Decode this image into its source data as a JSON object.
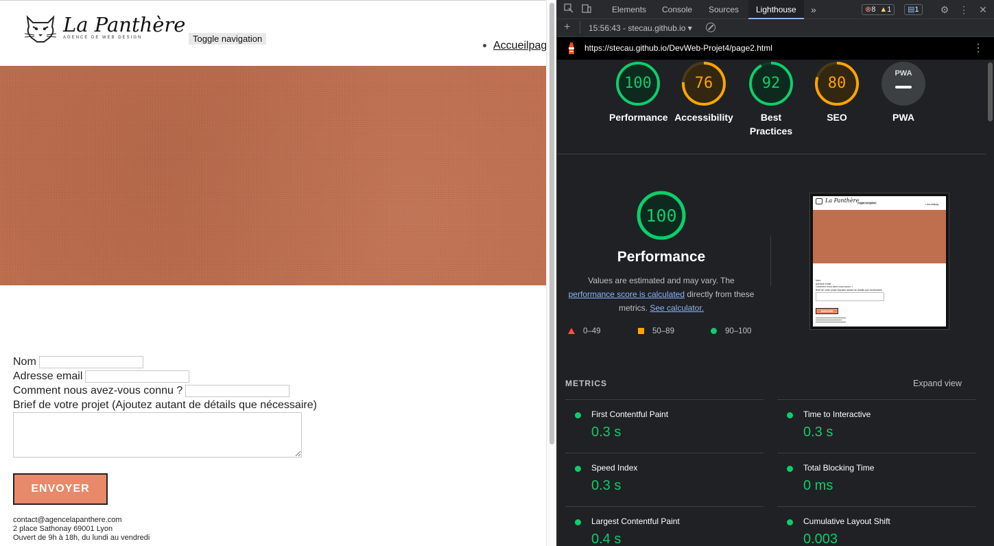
{
  "site": {
    "logo_title": "La Panthère",
    "logo_subtitle": "AGENCE DE WEB DESIGN",
    "toggle_nav": "Toggle navigation",
    "nav_items": [
      "Accueilpag"
    ],
    "form": {
      "name_label": "Nom",
      "email_label": "Adresse email",
      "source_label": "Comment nous avez-vous connu ?",
      "brief_label": "Brief de votre projet (Ajoutez autant de détails que nécessaire)",
      "submit": "ENVOYER"
    },
    "footer": [
      "contact@agencelapanthere.com",
      "2 place Sathonay 69001 Lyon",
      "Ouvert de 9h à 18h, du lundi au vendredi"
    ],
    "hero_color": "#bf6e4e",
    "button_color": "#e8896a"
  },
  "devtools": {
    "tabs": [
      "Elements",
      "Console",
      "Sources",
      "Lighthouse"
    ],
    "active_tab": "Lighthouse",
    "more_tabs": "»",
    "badges": {
      "errors": "8",
      "warnings": "1",
      "messages": "1"
    },
    "toolbar_report": "15:56:43 - stecau.github.io",
    "url": "https://stecau.github.io/DevWeb-Projet4/page2.html",
    "scores": [
      {
        "label": "Performance",
        "value": 100,
        "color": "#0cce6b"
      },
      {
        "label": "Accessibility",
        "value": 76,
        "color": "#ffa400"
      },
      {
        "label": "Best Practices",
        "value": 92,
        "color": "#0cce6b"
      },
      {
        "label": "SEO",
        "value": 80,
        "color": "#ffa400"
      },
      {
        "label": "PWA",
        "value": null,
        "color": "#9aa0a6",
        "badge_text": "PWA"
      }
    ],
    "performance": {
      "score": 100,
      "title": "Performance",
      "desc_before": "Values are estimated and may vary. The",
      "link_calc": "performance score is calculated",
      "desc_middle": "directly from these metrics.",
      "link_see": "See calculator."
    },
    "legend": [
      "0–49",
      "50–89",
      "90–100"
    ],
    "metrics_title": "METRICS",
    "expand_view": "Expand view",
    "metrics": [
      {
        "name": "First Contentful Paint",
        "value": "0.3 s"
      },
      {
        "name": "Time to Interactive",
        "value": "0.3 s"
      },
      {
        "name": "Speed Index",
        "value": "0.3 s"
      },
      {
        "name": "Total Blocking Time",
        "value": "0 ms"
      },
      {
        "name": "Largest Contentful Paint",
        "value": "0.4 s"
      },
      {
        "name": "Cumulative Layout Shift",
        "value": "0.003"
      }
    ],
    "thumbnail": {
      "logo": "La Panthère",
      "toggle": "Toggle navigation",
      "nav": "• Accueilpag",
      "lines": [
        "Nom",
        "Adresse email",
        "Comment nous avez-vous connu ?",
        "Brief de votre projet (Ajoutez autant de détails que nécessaire)"
      ],
      "button": "ENVOYER"
    }
  }
}
